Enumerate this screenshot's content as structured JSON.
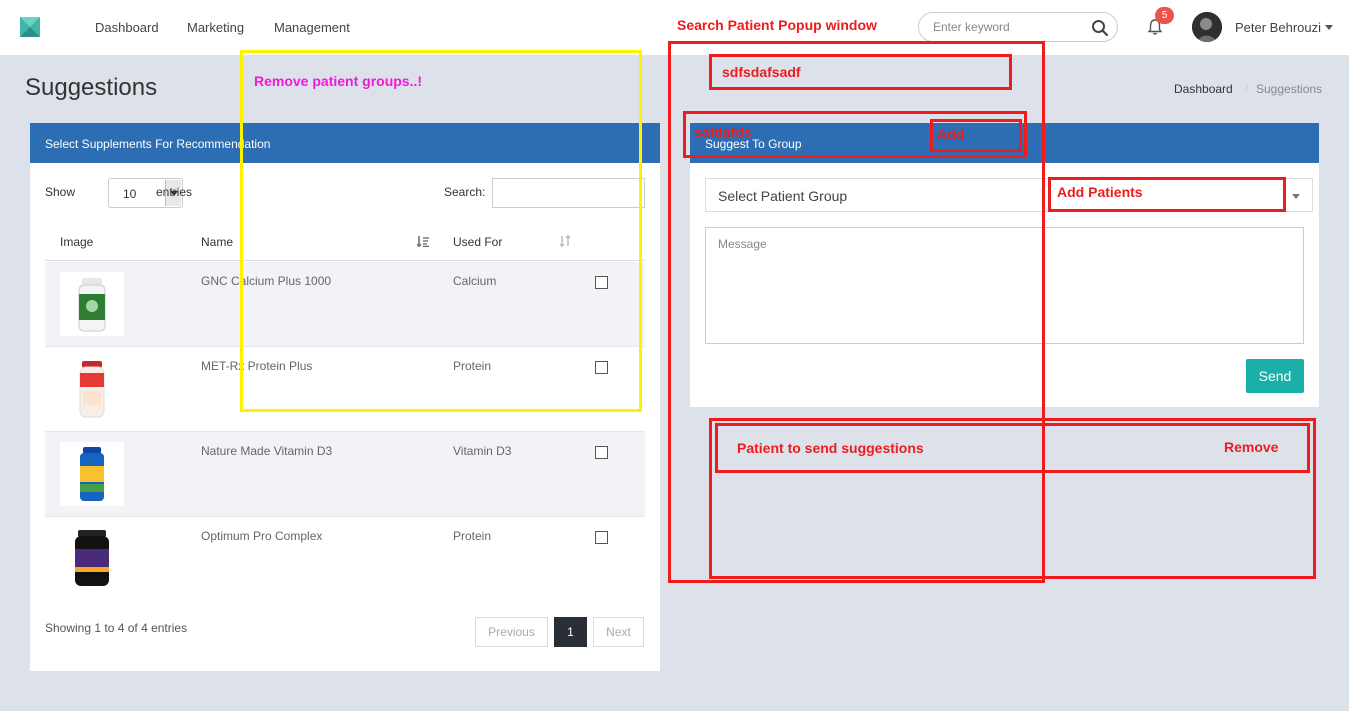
{
  "nav": {
    "links": [
      "Dashboard",
      "Marketing",
      "Management"
    ],
    "search_placeholder": "Enter keyword",
    "notification_count": "5",
    "user_name": "Peter Behrouzi"
  },
  "page": {
    "title": "Suggestions",
    "breadcrumb": [
      "Dashboard",
      "Suggestions"
    ],
    "breadcrumb_separator": "/"
  },
  "supplements_panel": {
    "header": "Select Supplements For Recommendation",
    "show_label": "Show",
    "entries_value": "10",
    "entries_label": "entries",
    "search_label": "Search:",
    "columns": [
      "Image",
      "Name",
      "Used For"
    ],
    "rows": [
      {
        "name": "GNC Calcium Plus 1000",
        "used_for": "Calcium",
        "image_icon": "white-bottle-green-label"
      },
      {
        "name": "MET-Rx Protein Plus",
        "used_for": "Protein",
        "image_icon": "white-jar-red-label"
      },
      {
        "name": "Nature Made Vitamin D3",
        "used_for": "Vitamin D3",
        "image_icon": "blue-bottle-yellow-label"
      },
      {
        "name": "Optimum Pro Complex",
        "used_for": "Protein",
        "image_icon": "black-tub-purple-label"
      }
    ],
    "footer_info": "Showing 1 to 4 of 4 entries",
    "pager": {
      "previous": "Previous",
      "current": "1",
      "next": "Next"
    }
  },
  "group_panel": {
    "header": "Suggest To Group",
    "select_value": "Select Patient Group",
    "message_placeholder": "Message",
    "send_label": "Send"
  },
  "annotations": {
    "popup_title": "Search Patient Popup window",
    "search_field": "sdfsdafsadf",
    "entry_text": "safdafds",
    "add": "Add",
    "add_patients": "Add Patients",
    "remove_groups": "Remove patient groups..!",
    "patient_list": "Patient to send suggestions",
    "remove": "Remove"
  },
  "colors": {
    "header_blue": "#2d6db3",
    "send_teal": "#1ab0a8",
    "annotation_red": "#ee1c1c",
    "annotation_yellow": "#fff200",
    "annotation_magenta": "#ee1ad8",
    "badge_red": "#f0514a"
  }
}
